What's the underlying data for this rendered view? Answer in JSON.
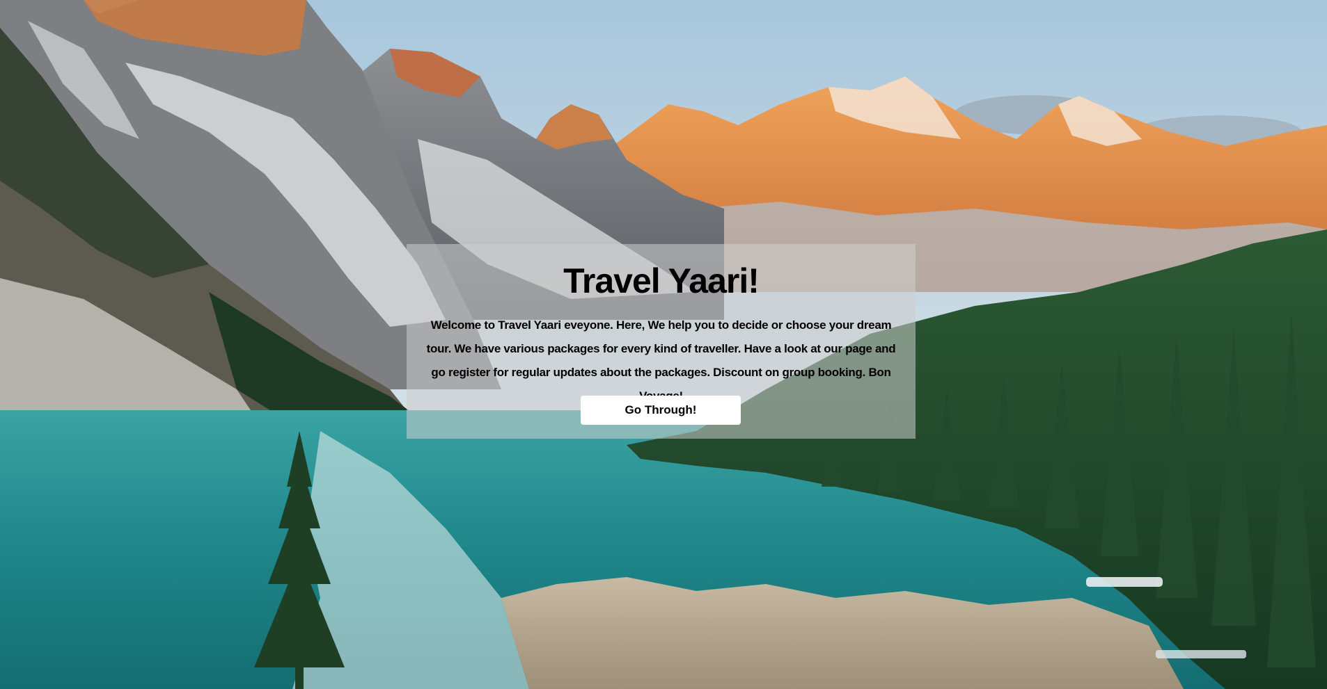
{
  "hero": {
    "title": "Travel Yaari!",
    "description": "Welcome to Travel Yaari eveyone. Here, We help you to decide or choose your dream tour. We have various packages for every kind of traveller. Have a look at our page and go register for regular updates about the packages. Discount on group booking. Bon Voyage!",
    "button_label": "Go Through!"
  },
  "colors": {
    "card_overlay": "#cdcdcd",
    "button_bg": "#ffffff",
    "text": "#000000",
    "lake": "#1f8a8c",
    "forest": "#1f4a2a",
    "sunlit_peaks": "#e48a3c",
    "sky": "#b4cfe0"
  },
  "background": {
    "scene": "mountain-lake-landscape"
  }
}
